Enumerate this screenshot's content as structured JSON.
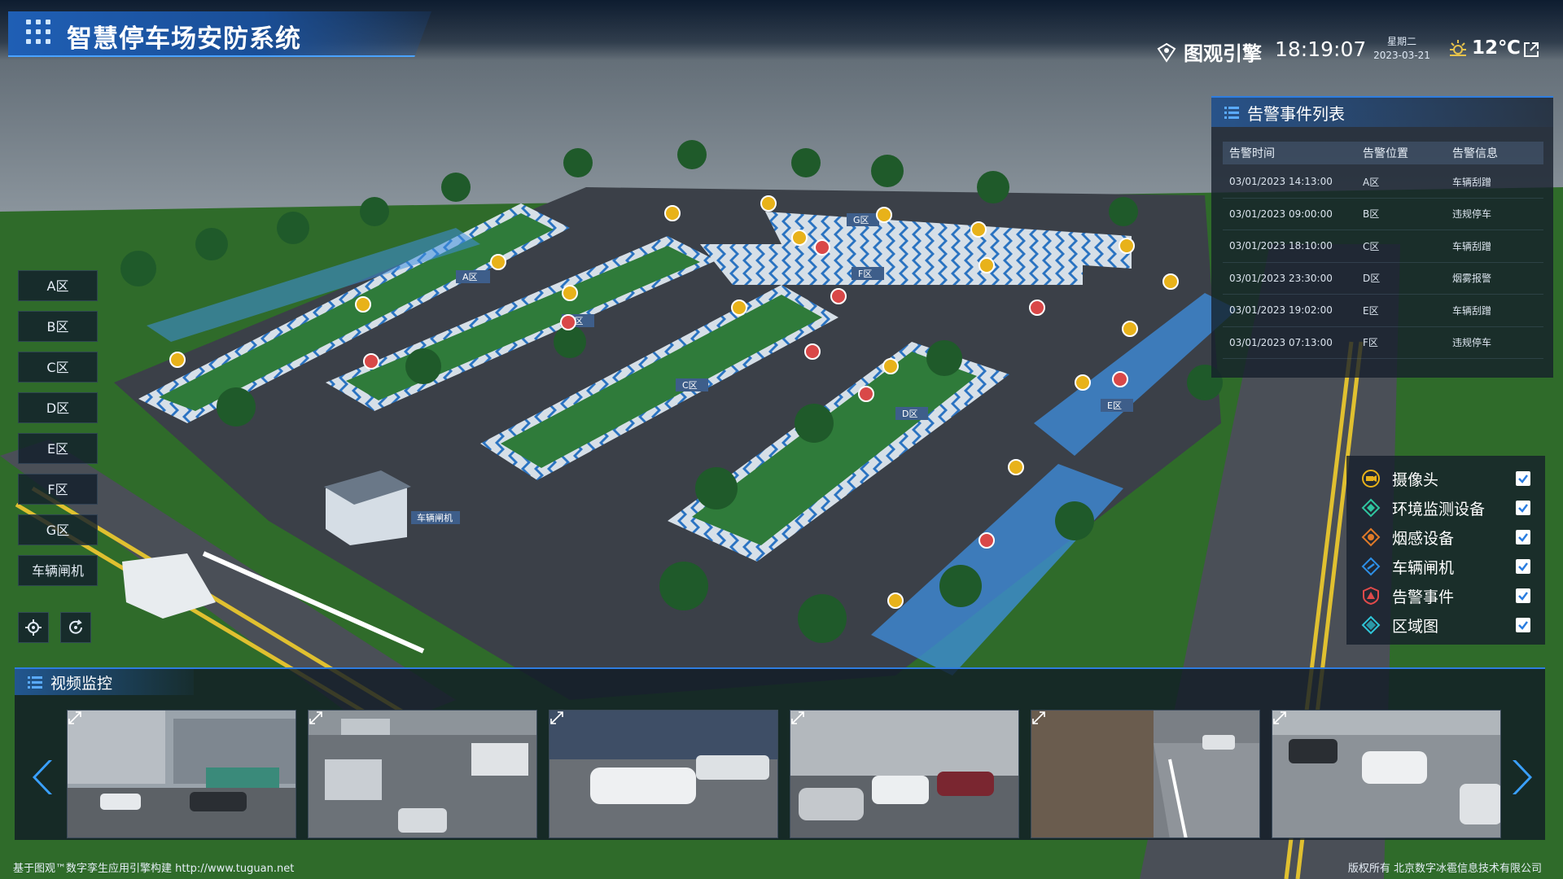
{
  "header": {
    "app_title": "智慧停车场安防系统",
    "brand_name": "图观引擎",
    "time": "18:19:07",
    "weekday": "星期二",
    "date": "2023-03-21",
    "temperature": "12℃"
  },
  "zone_menu": [
    "A区",
    "B区",
    "C区",
    "D区",
    "E区",
    "F区",
    "G区",
    "车辆闸机"
  ],
  "map_tags": [
    "A区",
    "B区",
    "C区",
    "D区",
    "E区",
    "F区",
    "G区",
    "车辆闸机"
  ],
  "alarm_panel": {
    "title": "告警事件列表",
    "columns": [
      "告警时间",
      "告警位置",
      "告警信息"
    ],
    "rows": [
      [
        "03/01/2023 14:13:00",
        "A区",
        "车辆刮蹭"
      ],
      [
        "03/01/2023 09:00:00",
        "B区",
        "违规停车"
      ],
      [
        "03/01/2023 18:10:00",
        "C区",
        "车辆刮蹭"
      ],
      [
        "03/01/2023 23:30:00",
        "D区",
        "烟雾报警"
      ],
      [
        "03/01/2023 19:02:00",
        "E区",
        "车辆刮蹭"
      ],
      [
        "03/01/2023 07:13:00",
        "F区",
        "违规停车"
      ]
    ]
  },
  "legend": [
    {
      "label": "摄像头",
      "icon": "camera-icon",
      "color": "#e8b21a",
      "checked": true
    },
    {
      "label": "环境监测设备",
      "icon": "environment-sensor-icon",
      "color": "#2fc6a0",
      "checked": true
    },
    {
      "label": "烟感设备",
      "icon": "smoke-detector-icon",
      "color": "#e07a28",
      "checked": true
    },
    {
      "label": "车辆闸机",
      "icon": "vehicle-gate-icon",
      "color": "#2d8fe6",
      "checked": true
    },
    {
      "label": "告警事件",
      "icon": "alarm-event-icon",
      "color": "#e04a4a",
      "checked": true
    },
    {
      "label": "区域图",
      "icon": "area-map-icon",
      "color": "#2fc6d8",
      "checked": true
    }
  ],
  "video_panel": {
    "title": "视频监控",
    "thumbnails": [
      "camera-feed-1",
      "camera-feed-2",
      "camera-feed-3",
      "camera-feed-4",
      "camera-feed-5",
      "camera-feed-6"
    ]
  },
  "footer": {
    "left": "基于图观™数字孪生应用引擎构建 http://www.tuguan.net",
    "right": "版权所有 北京数字冰雹信息技术有限公司"
  },
  "colors": {
    "accent": "#2e7de0",
    "zone_highlight": "#4aa3ff",
    "panel_bg": "#141e2a"
  }
}
